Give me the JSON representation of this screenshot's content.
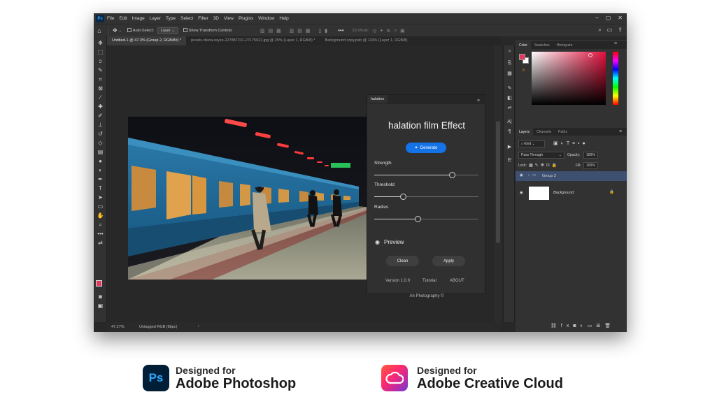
{
  "menu": {
    "app_icon": "Ps",
    "items": [
      "File",
      "Edit",
      "Image",
      "Layer",
      "Type",
      "Select",
      "Filter",
      "3D",
      "View",
      "Plugins",
      "Window",
      "Help"
    ]
  },
  "options_bar": {
    "auto_select_label": "Auto-Select:",
    "auto_select_value": "Layer",
    "transform_label": "Show Transform Controls",
    "mode_3d_label": "3D Mode:"
  },
  "tabs": [
    {
      "label": "Untitled-1 @ 47.3% (Group 2, RGB/8#) *",
      "active": true
    },
    {
      "label": "pexels-diana-reyes-227887231-27175022.jpg @ 25% (Layer 1, RGB/8) *",
      "active": false
    },
    {
      "label": "Background copy.psb @ 119% (Layer 1, RGB/8)",
      "active": false
    }
  ],
  "status_bar": {
    "zoom": "47.27%",
    "doc_info": "Untagged RGB (8bpc)"
  },
  "plugin": {
    "tab_label": "halation",
    "title": "halation film Effect",
    "generate_label": "Generate",
    "sliders": [
      {
        "label": "Strength",
        "value": 0.75
      },
      {
        "label": "Threshold",
        "value": 0.28
      },
      {
        "label": "Radius",
        "value": 0.42
      }
    ],
    "preview_label": "Preview",
    "clean_label": "Clean",
    "apply_label": "Apply",
    "version_label": "Version 1.0.0",
    "tutorial_label": "Tutorial",
    "about_label": "ABOUT",
    "credit": "Ah Photography ©"
  },
  "color_panel": {
    "tabs": [
      "Color",
      "Swatches",
      "Histogram"
    ],
    "foreground": "#e23a5c",
    "background": "#ffffff",
    "field_hue": "#e2113d"
  },
  "layers_panel": {
    "tabs": [
      "Layers",
      "Channels",
      "Paths"
    ],
    "filter_label": "Kind",
    "blend_mode": "Pass Through",
    "opacity_label": "Opacity:",
    "opacity_value": "100%",
    "lock_label": "Lock:",
    "fill_label": "Fill:",
    "fill_value": "100%",
    "layers": [
      {
        "name": "Group 2",
        "selected": true
      },
      {
        "name": "Background",
        "selected": false
      }
    ]
  },
  "branding": {
    "ps_designed_for": "Designed for",
    "ps_product": "Adobe Photoshop",
    "ps_badge": "Ps",
    "cc_designed_for": "Designed for",
    "cc_product": "Adobe Creative Cloud",
    "ps_color": "#001e36",
    "ps_accent": "#31a8ff"
  }
}
